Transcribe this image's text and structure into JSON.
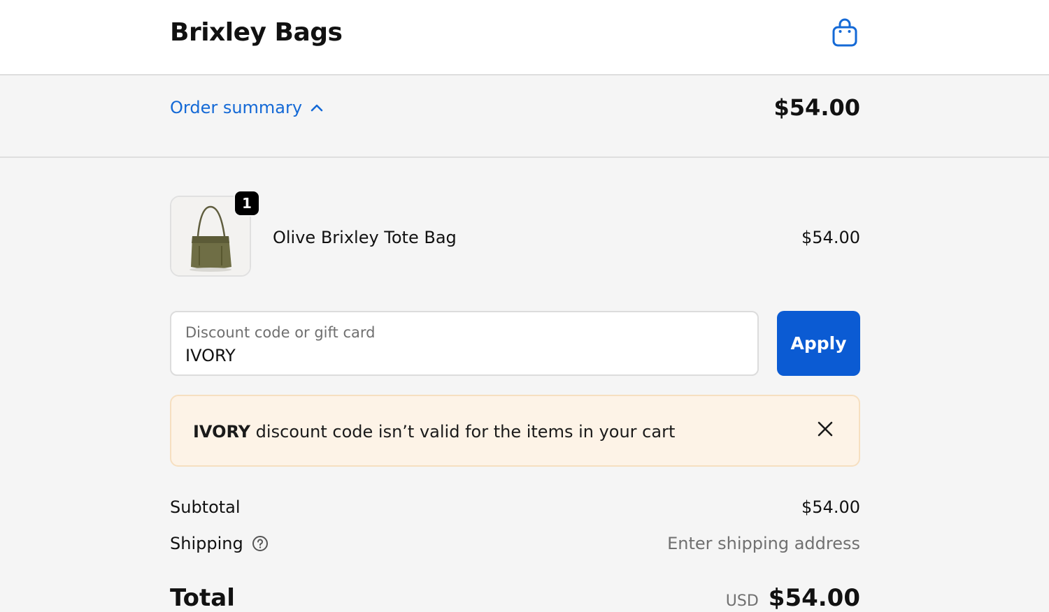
{
  "header": {
    "brand": "Brixley Bags",
    "cart_icon": "shopping-bag-icon"
  },
  "summary": {
    "toggle_label": "Order summary",
    "toggle_icon": "chevron-up-icon",
    "total": "$54.00"
  },
  "line_items": [
    {
      "name": "Olive Brixley Tote Bag",
      "quantity": "1",
      "price": "$54.00"
    }
  ],
  "discount": {
    "label": "Discount code or gift card",
    "value": "IVORY",
    "apply_label": "Apply"
  },
  "alert": {
    "code": "IVORY",
    "message": " discount code isn’t valid for the items in your cart",
    "close_icon": "close-icon"
  },
  "totals": {
    "subtotal_label": "Subtotal",
    "subtotal_value": "$54.00",
    "shipping_label": "Shipping",
    "shipping_value": "Enter shipping address",
    "total_label": "Total",
    "currency": "USD",
    "total_value": "$54.00"
  },
  "colors": {
    "accent": "#0b5bd3",
    "link": "#1469d6",
    "alert_bg": "#fdf3e7"
  }
}
